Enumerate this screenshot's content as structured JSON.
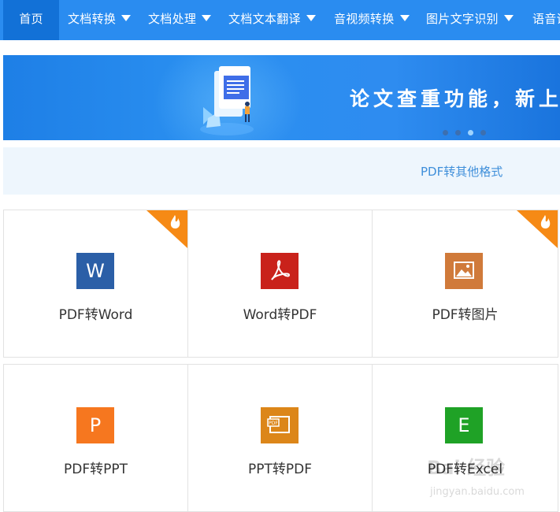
{
  "nav": {
    "items": [
      {
        "label": "首页",
        "active": true,
        "dropdown": false
      },
      {
        "label": "文档转换",
        "active": false,
        "dropdown": true
      },
      {
        "label": "文档处理",
        "active": false,
        "dropdown": true
      },
      {
        "label": "文档文本翻译",
        "active": false,
        "dropdown": true
      },
      {
        "label": "音视频转换",
        "active": false,
        "dropdown": true
      },
      {
        "label": "图片文字识别",
        "active": false,
        "dropdown": true
      },
      {
        "label": "语音识",
        "active": false,
        "dropdown": false
      }
    ]
  },
  "banner": {
    "headline": "论文查重功能，新上线",
    "dots_count": 4,
    "active_dot_index": 2
  },
  "substrip": {
    "link": "PDF转其他格式"
  },
  "tools": [
    {
      "label": "PDF转Word",
      "icon_letter": "W",
      "icon_name": "word-icon",
      "color": "#2b5fa7",
      "hot": true
    },
    {
      "label": "Word转PDF",
      "icon_letter": "",
      "icon_name": "pdf-acrobat-icon",
      "color": "#c9221b",
      "hot": false
    },
    {
      "label": "PDF转图片",
      "icon_letter": "",
      "icon_name": "image-icon",
      "color": "#d07a3a",
      "hot": true
    },
    {
      "label": "PDF转PPT",
      "icon_letter": "P",
      "icon_name": "ppt-icon",
      "color": "#f6771f",
      "hot": false
    },
    {
      "label": "PPT转PDF",
      "icon_letter": "",
      "icon_name": "ppt-pdf-icon",
      "color": "#dc8619",
      "hot": false
    },
    {
      "label": "PDF转Excel",
      "icon_letter": "E",
      "icon_name": "excel-icon",
      "color": "#1fa226",
      "hot": false
    }
  ],
  "colors": {
    "nav_bg": "#2a8cf0",
    "nav_active": "#1271d7",
    "hot_badge": "#f68a15",
    "link": "#3f8fda"
  },
  "watermark": {
    "line1": "Bai 经验",
    "line2": "jingyan.baidu.com"
  }
}
